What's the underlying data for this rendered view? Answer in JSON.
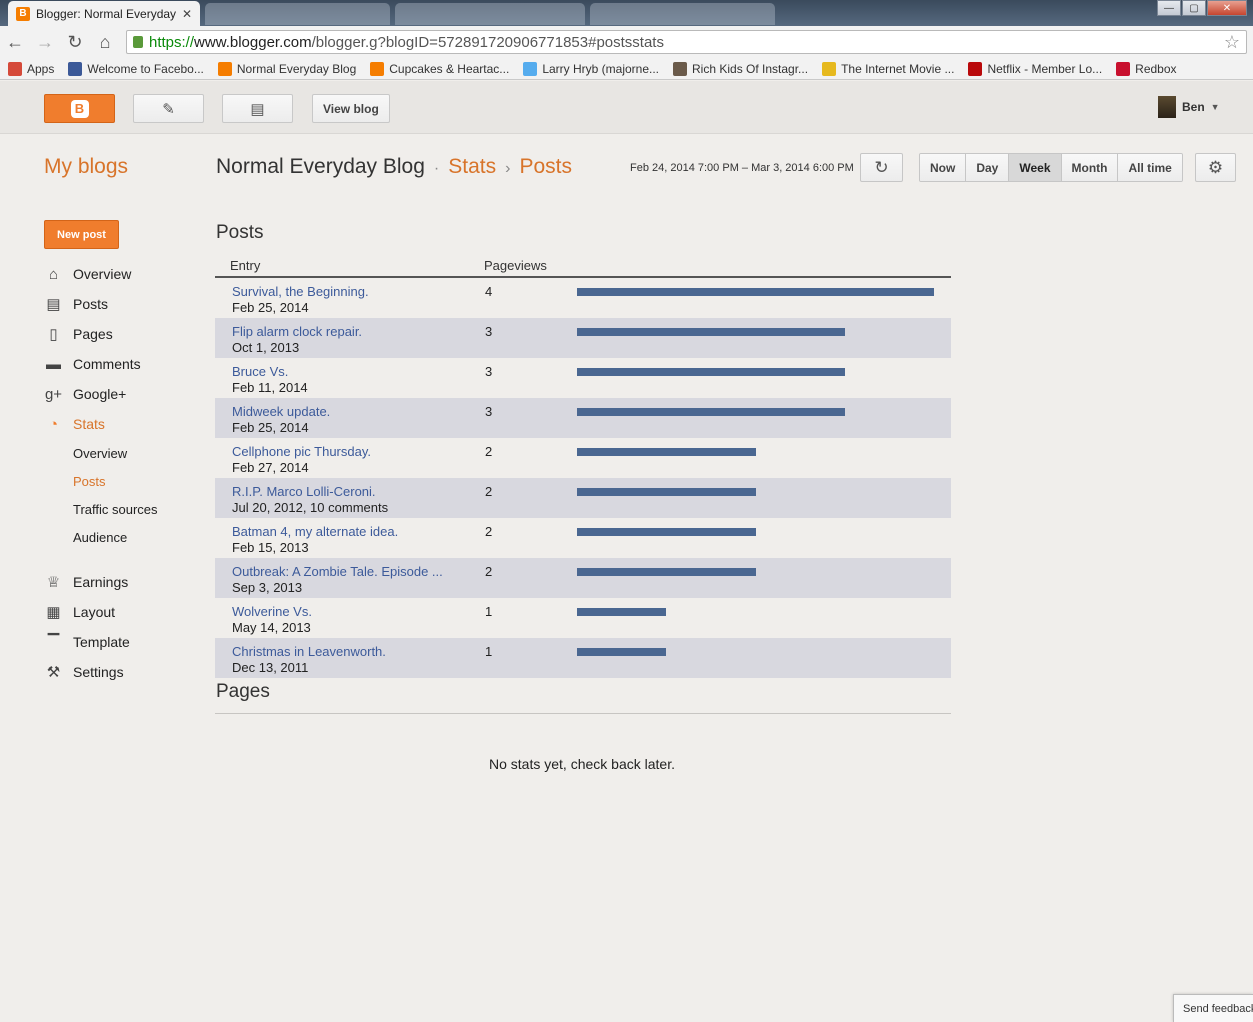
{
  "browser": {
    "tab_title": "Blogger: Normal Everyday",
    "url_scheme": "https://",
    "url_host": "www.blogger.com",
    "url_path": "/blogger.g?blogID=572891720906771853#postsstats",
    "bookmarks": [
      {
        "label": "Apps",
        "icon": "apps-grid-icon",
        "color": "#d54a3a"
      },
      {
        "label": "Welcome to Facebo...",
        "icon": "facebook-icon",
        "color": "#3b5998"
      },
      {
        "label": "Normal Everyday Blog",
        "icon": "blogger-icon",
        "color": "#f57d00"
      },
      {
        "label": "Cupcakes & Heartac...",
        "icon": "blogger-icon",
        "color": "#f57d00"
      },
      {
        "label": "Larry Hryb (majorne...",
        "icon": "twitter-icon",
        "color": "#55acee"
      },
      {
        "label": "Rich Kids Of Instagr...",
        "icon": "image-icon",
        "color": "#6a5a4a"
      },
      {
        "label": "The Internet Movie ...",
        "icon": "imdb-icon",
        "color": "#e6b91e"
      },
      {
        "label": "Netflix - Member Lo...",
        "icon": "netflix-icon",
        "color": "#b9090b"
      },
      {
        "label": "Redbox",
        "icon": "redbox-icon",
        "color": "#c8102e"
      }
    ]
  },
  "appbar": {
    "view_blog_label": "View blog",
    "user_name": "Ben"
  },
  "header": {
    "my_blogs": "My blogs",
    "blog_name": "Normal Everyday Blog",
    "sep_dot": "·",
    "crumb_stats": "Stats",
    "sep_arrow": "›",
    "crumb_posts": "Posts",
    "date_range": "Feb 24, 2014 7:00 PM – Mar 3, 2014 6:00 PM",
    "range_buttons": [
      "Now",
      "Day",
      "Week",
      "Month",
      "All time"
    ],
    "active_range": "Week"
  },
  "sidebar": {
    "new_post_label": "New post",
    "items": [
      {
        "label": "Overview",
        "icon": "home-icon"
      },
      {
        "label": "Posts",
        "icon": "posts-icon"
      },
      {
        "label": "Pages",
        "icon": "pages-icon"
      },
      {
        "label": "Comments",
        "icon": "comment-icon"
      },
      {
        "label": "Google+",
        "icon": "google-plus-icon"
      },
      {
        "label": "Stats",
        "icon": "pie-chart-icon"
      }
    ],
    "stats_sub": [
      "Overview",
      "Posts",
      "Traffic sources",
      "Audience"
    ],
    "items2": [
      {
        "label": "Earnings",
        "icon": "trophy-icon"
      },
      {
        "label": "Layout",
        "icon": "layout-icon"
      },
      {
        "label": "Template",
        "icon": "paint-roller-icon"
      },
      {
        "label": "Settings",
        "icon": "wrench-icon"
      }
    ]
  },
  "posts_section": {
    "title": "Posts",
    "col_entry": "Entry",
    "col_pageviews": "Pageviews",
    "rows": [
      {
        "title": "Survival, the Beginning.",
        "date": "Feb 25, 2014",
        "pageviews": 4
      },
      {
        "title": "Flip alarm clock repair.",
        "date": "Oct 1, 2013",
        "pageviews": 3
      },
      {
        "title": "Bruce Vs.",
        "date": "Feb 11, 2014",
        "pageviews": 3
      },
      {
        "title": "Midweek update.",
        "date": "Feb 25, 2014",
        "pageviews": 3
      },
      {
        "title": "Cellphone pic Thursday.",
        "date": "Feb 27, 2014",
        "pageviews": 2
      },
      {
        "title": "R.I.P. Marco Lolli-Ceroni.",
        "date": "Jul 20, 2012, 10 comments",
        "pageviews": 2
      },
      {
        "title": "Batman 4, my alternate idea.",
        "date": "Feb 15, 2013",
        "pageviews": 2
      },
      {
        "title": "Outbreak: A Zombie Tale. Episode ...",
        "date": "Sep 3, 2013",
        "pageviews": 2
      },
      {
        "title": "Wolverine Vs.",
        "date": "May 14, 2013",
        "pageviews": 1
      },
      {
        "title": "Christmas in Leavenworth.",
        "date": "Dec 13, 2011",
        "pageviews": 1
      }
    ]
  },
  "pages_section": {
    "title": "Pages",
    "empty_message": "No stats yet, check back later."
  },
  "feedback_label": "Send feedback",
  "colors": {
    "accent": "#f07d2d",
    "link": "#3c5a9a",
    "bar": "#4a6791"
  }
}
